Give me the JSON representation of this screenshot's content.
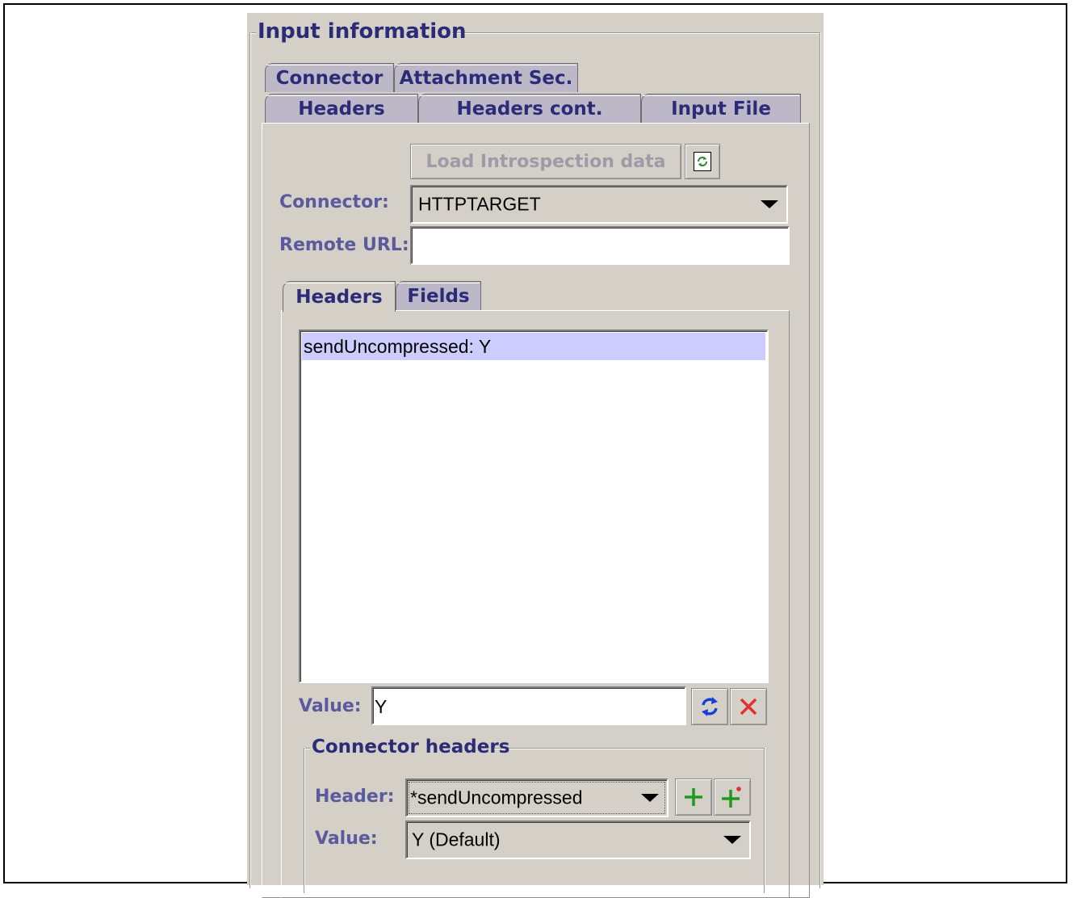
{
  "group_title": "Input information",
  "tabs_row_back": [
    {
      "label": "Connector"
    },
    {
      "label": "Attachment Sec."
    }
  ],
  "tabs_row_front": [
    {
      "label": "Headers"
    },
    {
      "label": "Headers cont."
    },
    {
      "label": "Input File"
    }
  ],
  "connector_tab": {
    "load_button_label": "Load Introspection data",
    "connector_label": "Connector:",
    "connector_value": "HTTPTARGET",
    "remote_url_label": "Remote URL:",
    "remote_url_value": ""
  },
  "inner_tabs": [
    {
      "label": "Headers"
    },
    {
      "label": "Fields"
    }
  ],
  "headers_list": [
    {
      "text": "sendUncompressed: Y",
      "selected": true
    }
  ],
  "value_row": {
    "label": "Value:",
    "value": "Y"
  },
  "connector_headers": {
    "title": "Connector headers",
    "header_label": "Header:",
    "header_value": "*sendUncompressed",
    "value_label": "Value:",
    "value_value": "Y (Default)"
  },
  "colors": {
    "panel": "#d4d0c8",
    "label": "#5a5a9c",
    "tab_text": "#2b2b77",
    "selection": "#ccccff"
  }
}
